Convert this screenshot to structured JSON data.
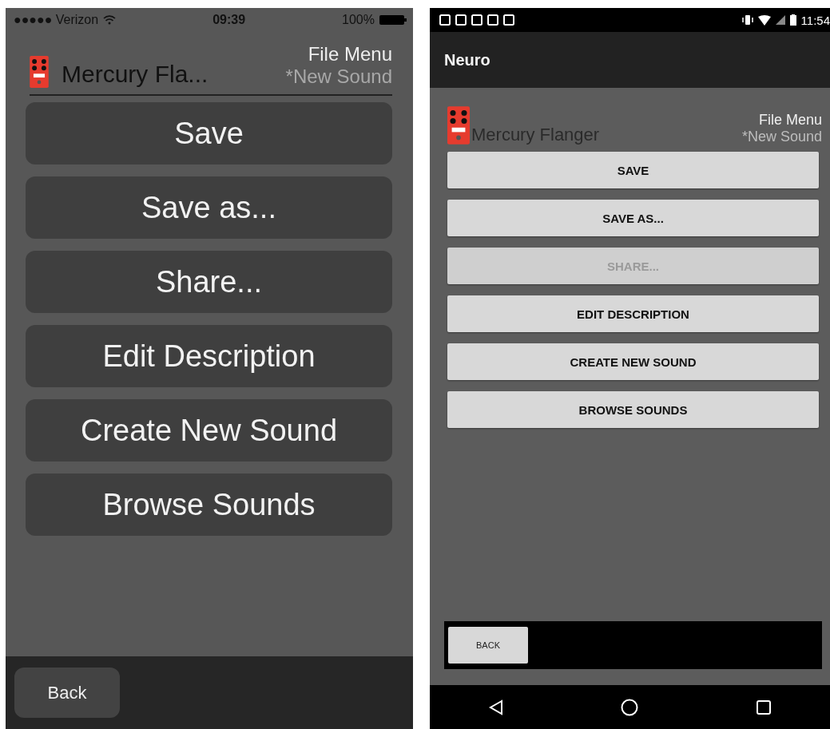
{
  "ios_screen": {
    "status_bar": {
      "carrier": "●●●●● Verizon",
      "time": "09:39",
      "battery": "100%"
    },
    "header": {
      "pedal_name": "Mercury Fla...",
      "menu_title": "File Menu",
      "sound_name": "*New Sound"
    },
    "menu_items": [
      {
        "label": "Save"
      },
      {
        "label": "Save as..."
      },
      {
        "label": "Share..."
      },
      {
        "label": "Edit Description"
      },
      {
        "label": "Create New Sound"
      },
      {
        "label": "Browse Sounds"
      }
    ],
    "back_button": "Back"
  },
  "android_screen": {
    "status_bar": {
      "time": "11:54"
    },
    "app_title": "Neuro",
    "header": {
      "pedal_name": "Mercury Flanger",
      "menu_title": "File Menu",
      "sound_name": "*New Sound"
    },
    "menu_items": [
      {
        "label": "SAVE",
        "disabled": false
      },
      {
        "label": "SAVE AS...",
        "disabled": false
      },
      {
        "label": "SHARE...",
        "disabled": true
      },
      {
        "label": "EDIT DESCRIPTION",
        "disabled": false
      },
      {
        "label": "CREATE NEW SOUND",
        "disabled": false
      },
      {
        "label": "BROWSE SOUNDS",
        "disabled": false
      }
    ],
    "back_button": "BACK"
  }
}
